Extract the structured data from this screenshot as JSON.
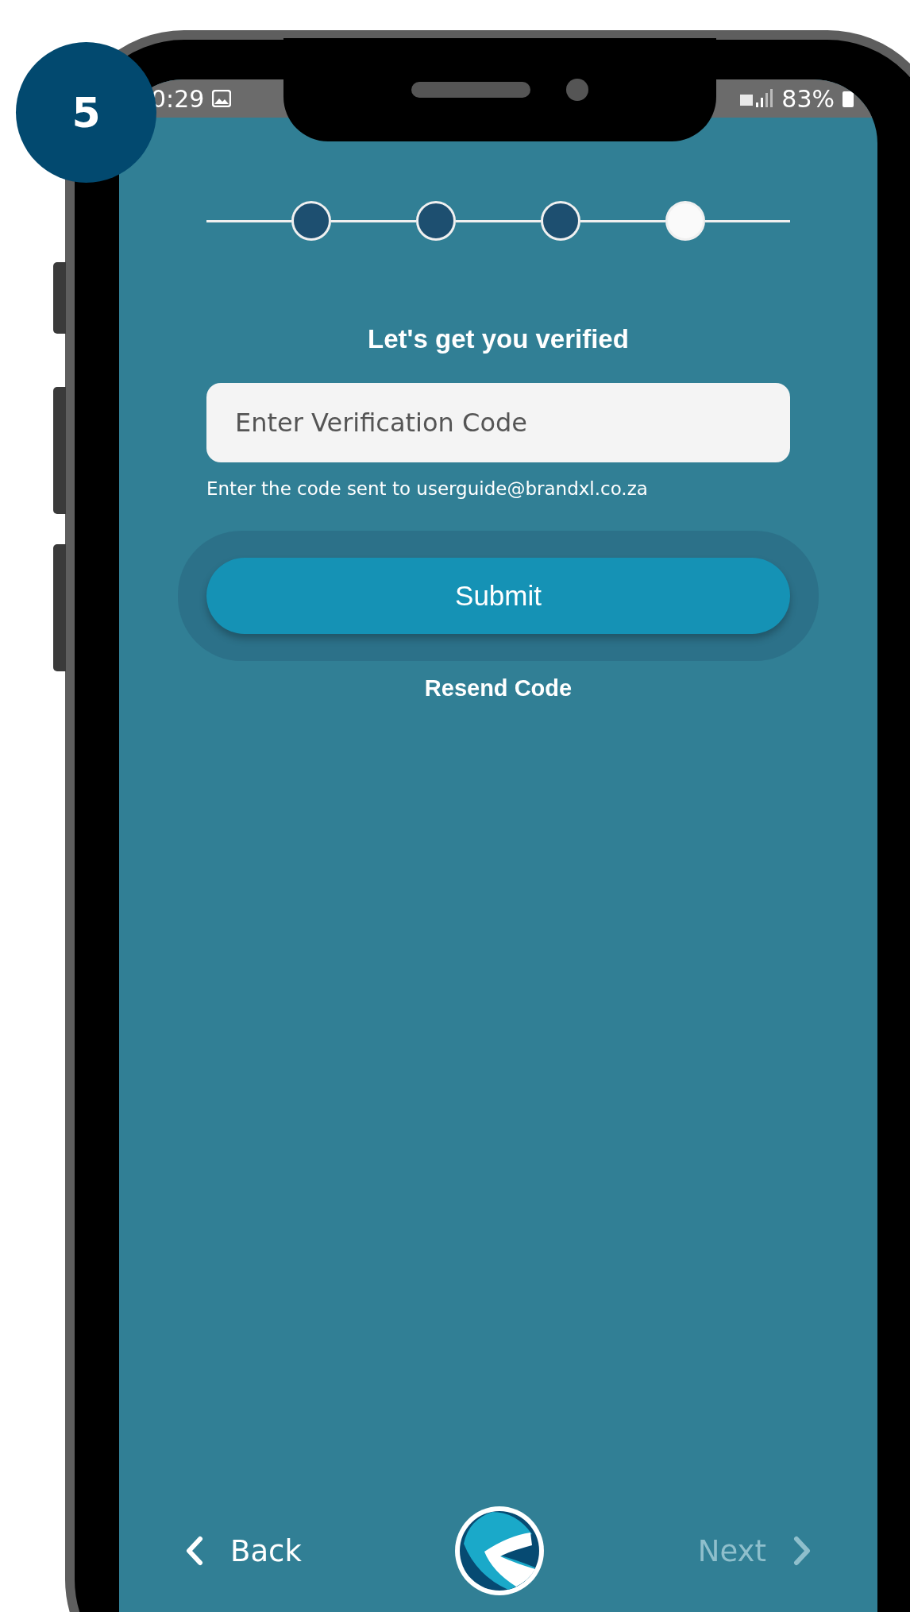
{
  "badge": "5",
  "status_bar": {
    "time": "0:29",
    "battery": "83%"
  },
  "steps": [
    {
      "selected": false
    },
    {
      "selected": false
    },
    {
      "selected": false
    },
    {
      "selected": true
    }
  ],
  "title": "Let's get you verified",
  "code_field": {
    "placeholder": "Enter Verification Code"
  },
  "hint": "Enter the code sent to userguide@brandxl.co.za",
  "submit": "Submit",
  "resend": "Resend Code",
  "nav": {
    "back": "Back",
    "next": "Next",
    "next_disabled": true
  }
}
